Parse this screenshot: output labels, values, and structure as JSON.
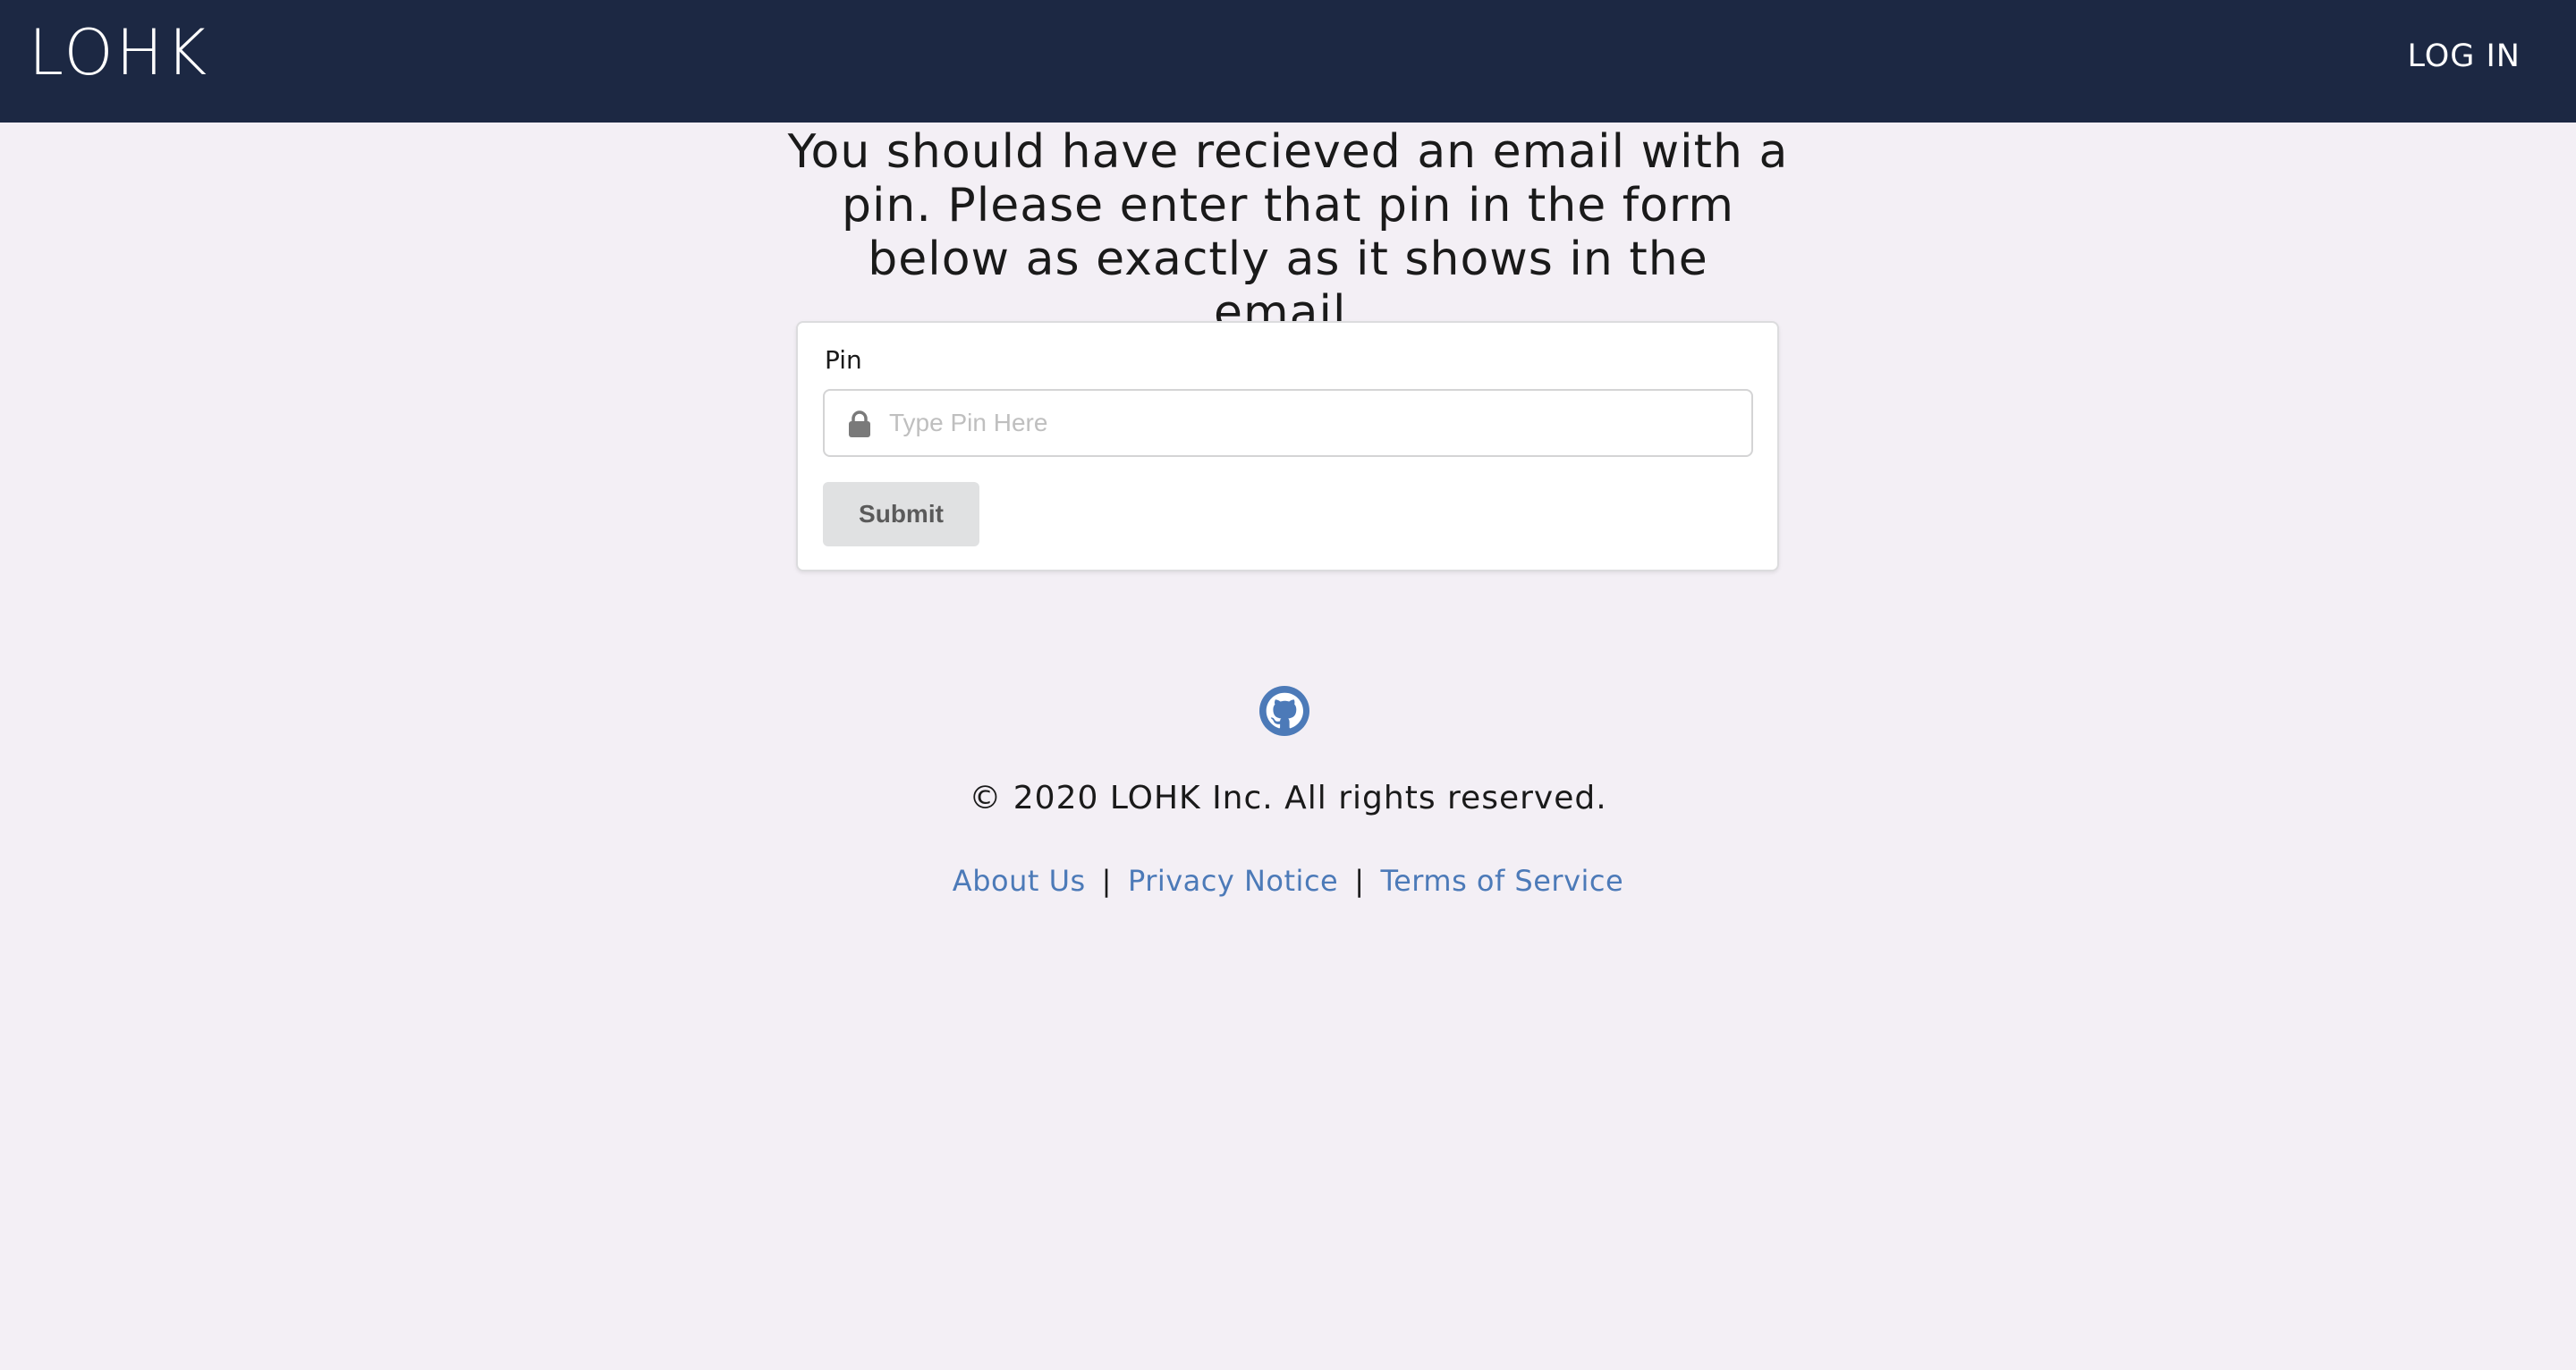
{
  "navbar": {
    "brand": "LOHK",
    "login_label": "LOG IN",
    "background_color": "#1c2843"
  },
  "main": {
    "headline": "You should have recieved an email with a pin. Please enter that pin in the form below as exactly as it shows in the email."
  },
  "form": {
    "pin_label": "Pin",
    "pin_placeholder": "Type Pin Here",
    "pin_value": "",
    "input_icon": "lock-icon",
    "submit_label": "Submit"
  },
  "footer": {
    "icon": "github-icon",
    "copyright": "© 2020 LOHK Inc. All rights reserved.",
    "links": [
      {
        "label": "About Us"
      },
      {
        "label": "Privacy Notice"
      },
      {
        "label": "Terms of Service"
      }
    ],
    "separator": "|",
    "link_color": "#4c7ab8"
  }
}
